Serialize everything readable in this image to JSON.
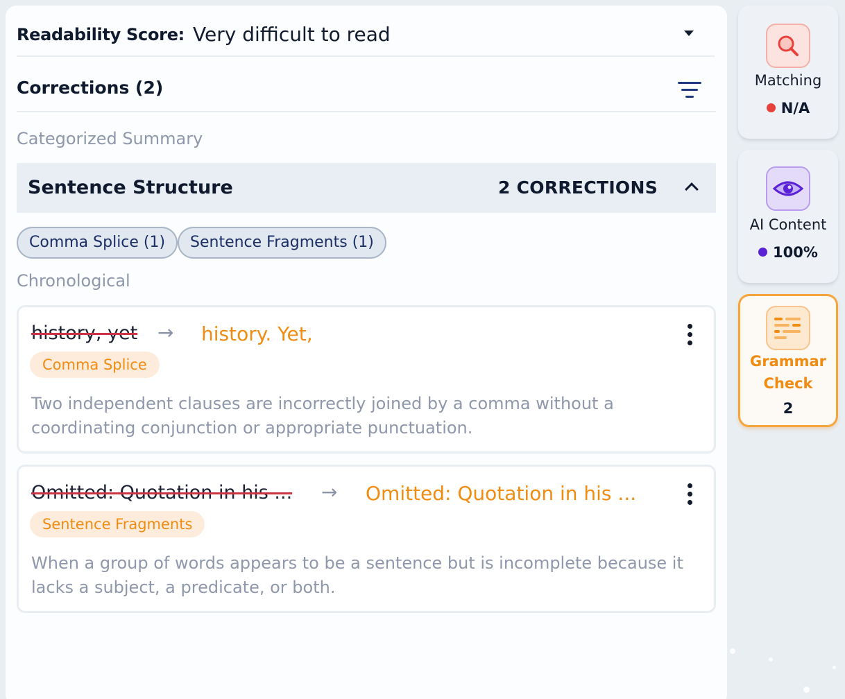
{
  "readability": {
    "label": "Readability Score:",
    "value": "Very difficult to read"
  },
  "corrections": {
    "title": "Corrections (2)"
  },
  "sections": {
    "categorized": "Categorized Summary",
    "chronological": "Chronological"
  },
  "category": {
    "name": "Sentence Structure",
    "count": "2 CORRECTIONS"
  },
  "chips": [
    {
      "label": "Comma Splice (1)"
    },
    {
      "label": "Sentence Fragments (1)"
    }
  ],
  "cards": [
    {
      "original": "history, yet",
      "suggestion": "history. Yet,",
      "tag": "Comma Splice",
      "description": "Two independent clauses are incorrectly joined by a comma without a coordinating conjunction or appropriate punctuation."
    },
    {
      "original": "Omitted: Quotation in his ...",
      "suggestion": "Omitted: Quotation in his ...",
      "tag": "Sentence Fragments",
      "description": "When a group of words appears to be a sentence but is incomplete because it lacks a subject, a predicate, or both."
    }
  ],
  "arrow": "→",
  "tools": [
    {
      "name": "Matching",
      "value": "N/A",
      "dot_color": "#e8413b",
      "icon": "magnifier-icon"
    },
    {
      "name": "AI Content",
      "value": "100%",
      "dot_color": "#5a22d6",
      "icon": "eye-icon"
    },
    {
      "name": "Grammar Check",
      "name_line1": "Grammar",
      "name_line2": "Check",
      "value": "2",
      "icon": "grammar-lines-icon"
    }
  ],
  "colors": {
    "accent_orange": "#f08c12",
    "strike_red": "#cc3344",
    "filter_blue": "#1d3a80"
  }
}
